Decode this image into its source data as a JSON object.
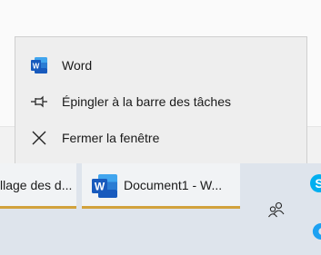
{
  "context_menu": {
    "items": [
      {
        "label": "Word",
        "icon": "word-icon"
      },
      {
        "label": "Épingler à la barre des tâches",
        "icon": "pin-icon"
      },
      {
        "label": "Fermer la fenêtre",
        "icon": "close-icon"
      }
    ]
  },
  "taskbar": {
    "items": [
      {
        "label": "llage des d...",
        "active": false
      },
      {
        "label": "Document1 - W...",
        "active": true,
        "icon": "word-icon"
      }
    ],
    "tray": {
      "people_icon": "people-icon",
      "skype_icon": "skype-icon",
      "edge_icon": "edge-icon"
    }
  },
  "colors": {
    "accent_underline": "#d2a23c",
    "word_blue": "#185abd",
    "skype_blue": "#00aff0"
  }
}
